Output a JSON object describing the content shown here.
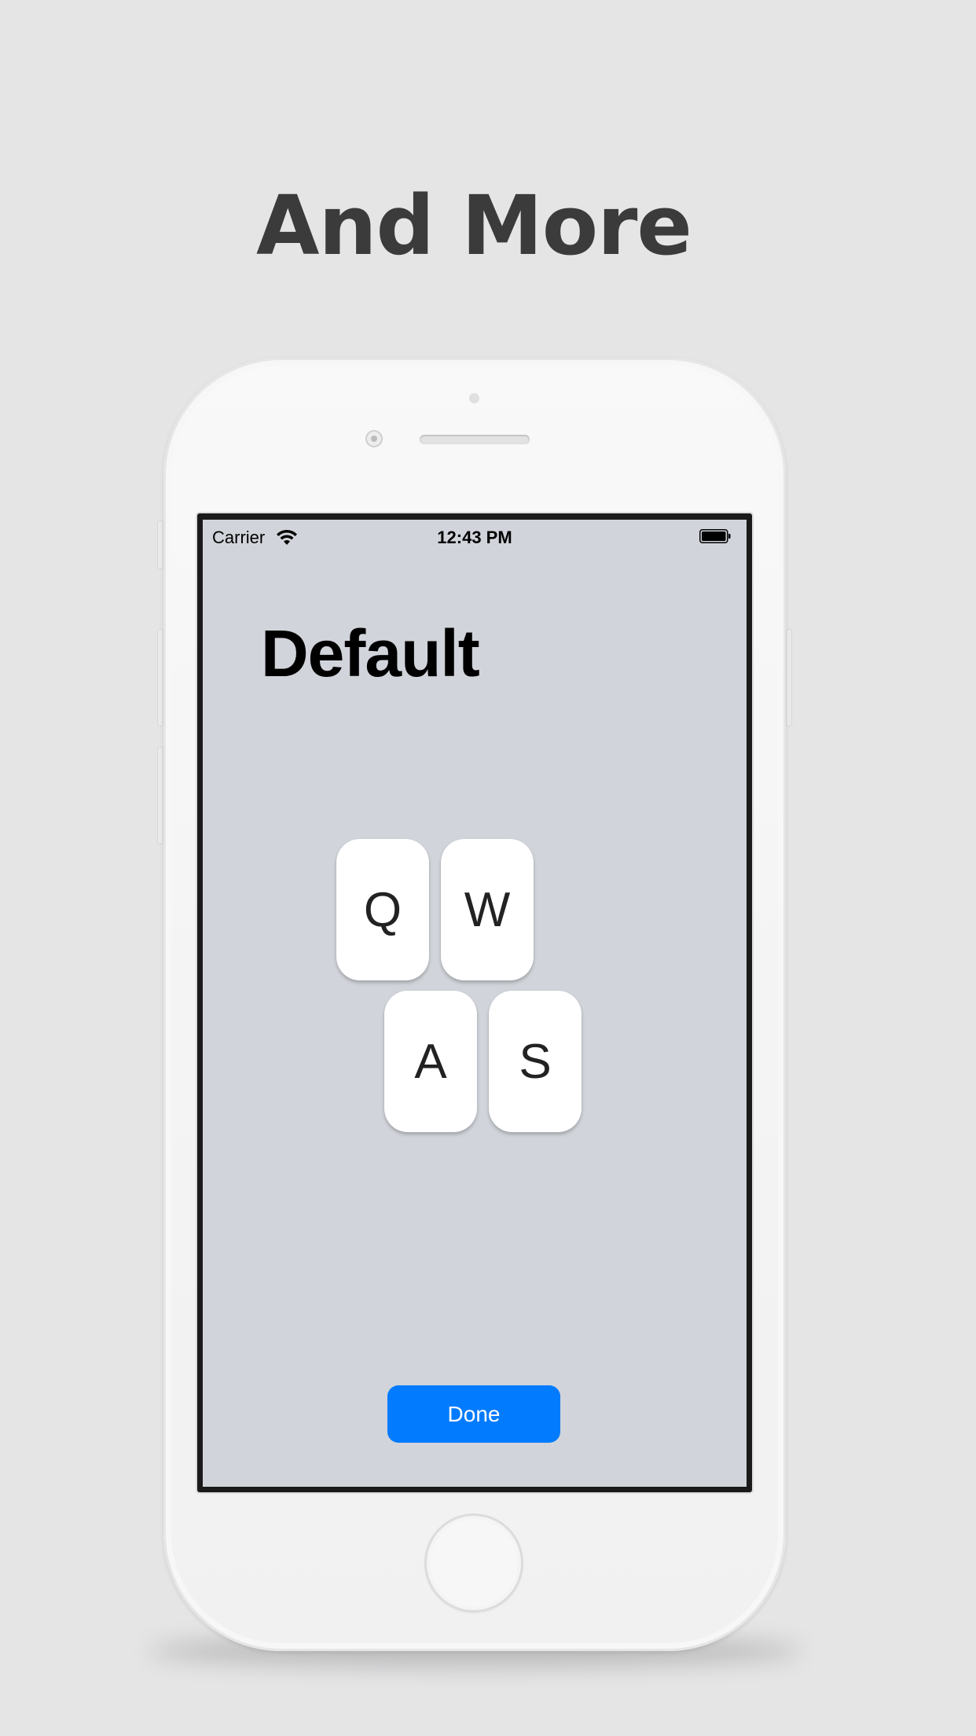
{
  "promo": {
    "headline": "And More"
  },
  "status_bar": {
    "carrier": "Carrier",
    "time": "12:43 PM",
    "wifi_icon": "wifi-icon",
    "battery_icon": "battery-full-icon"
  },
  "screen": {
    "title": "Default",
    "keys": [
      "Q",
      "W",
      "A",
      "S"
    ],
    "done_label": "Done"
  },
  "colors": {
    "background": "#e5e5e6",
    "headline": "#3b3b3b",
    "screen_background": "#d1d4da",
    "key_background": "#ffffff",
    "done_button": "#037bfe"
  }
}
